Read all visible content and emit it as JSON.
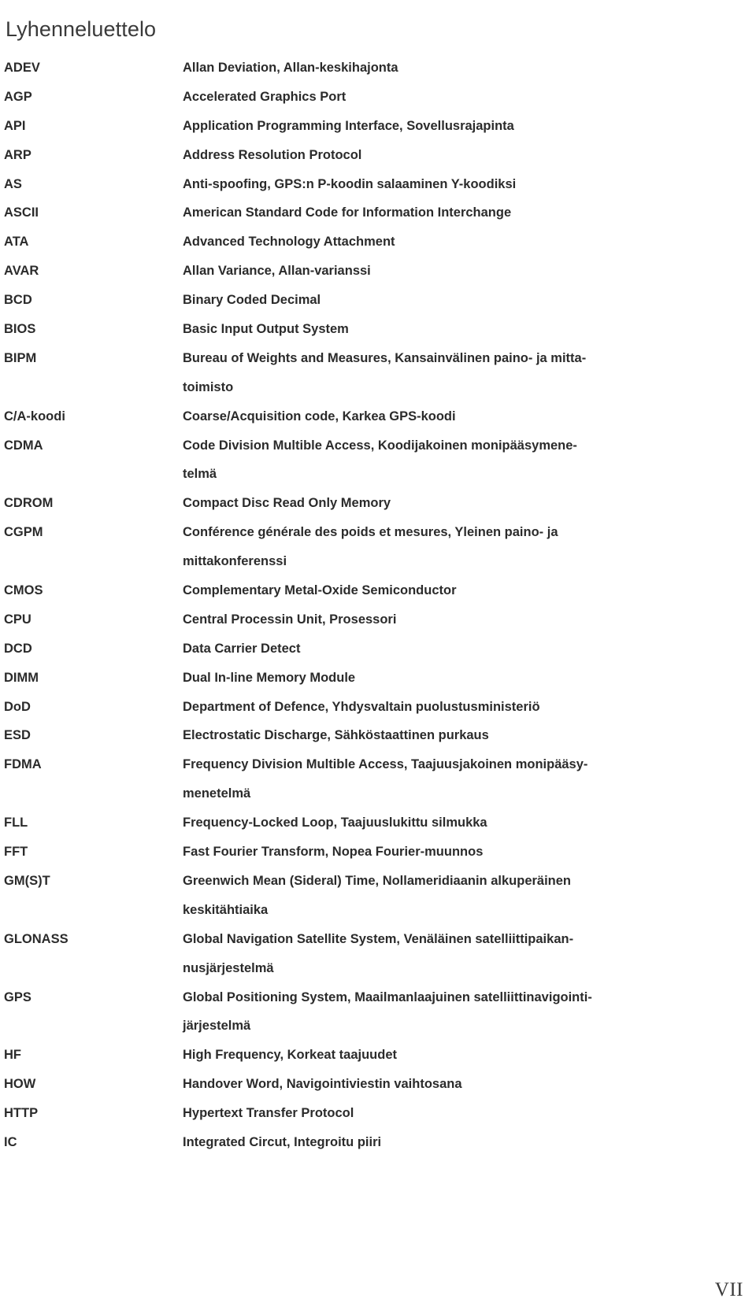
{
  "document": {
    "title": "Lyhenneluettelo",
    "page_number": "VII"
  },
  "entries": [
    {
      "term": "ADEV",
      "lines": [
        "Allan Deviation, Allan-keskihajonta"
      ]
    },
    {
      "term": "AGP",
      "lines": [
        "Accelerated Graphics Port"
      ]
    },
    {
      "term": "API",
      "lines": [
        "Application Programming Interface, Sovellusrajapinta"
      ]
    },
    {
      "term": "ARP",
      "lines": [
        "Address Resolution Protocol"
      ]
    },
    {
      "term": "AS",
      "lines": [
        "Anti-spoofing, GPS:n P-koodin salaaminen Y-koodiksi"
      ]
    },
    {
      "term": "ASCII",
      "lines": [
        "American Standard Code for Information Interchange"
      ]
    },
    {
      "term": "ATA",
      "lines": [
        "Advanced Technology Attachment"
      ]
    },
    {
      "term": "AVAR",
      "lines": [
        "Allan Variance, Allan-varianssi"
      ]
    },
    {
      "term": "BCD",
      "lines": [
        "Binary Coded Decimal"
      ]
    },
    {
      "term": "BIOS",
      "lines": [
        "Basic Input Output System"
      ]
    },
    {
      "term": "BIPM",
      "lines": [
        "Bureau of Weights and Measures, Kansainvälinen paino- ja mitta-",
        "toimisto"
      ]
    },
    {
      "term": "C/A-koodi",
      "lines": [
        "Coarse/Acquisition code, Karkea GPS-koodi"
      ]
    },
    {
      "term": "CDMA",
      "lines": [
        "Code Division Multible Access, Koodijakoinen monipääsymene-",
        "telmä"
      ]
    },
    {
      "term": "CDROM",
      "lines": [
        "Compact Disc Read Only Memory"
      ]
    },
    {
      "term": "CGPM",
      "lines": [
        "Conférence générale des poids et mesures, Yleinen paino- ja",
        "mittakonferenssi"
      ]
    },
    {
      "term": "CMOS",
      "lines": [
        "Complementary Metal-Oxide Semiconductor"
      ]
    },
    {
      "term": "CPU",
      "lines": [
        "Central Processin Unit, Prosessori"
      ]
    },
    {
      "term": "DCD",
      "lines": [
        "Data Carrier Detect"
      ]
    },
    {
      "term": "DIMM",
      "lines": [
        "Dual In-line Memory Module"
      ]
    },
    {
      "term": "DoD",
      "lines": [
        "Department of Defence, Yhdysvaltain puolustusministeriö"
      ]
    },
    {
      "term": "ESD",
      "lines": [
        "Electrostatic Discharge, Sähköstaattinen purkaus"
      ]
    },
    {
      "term": "FDMA",
      "lines": [
        "Frequency Division Multible Access, Taajuusjakoinen monipääsy-",
        "menetelmä"
      ]
    },
    {
      "term": "FLL",
      "lines": [
        "Frequency-Locked Loop, Taajuuslukittu silmukka"
      ]
    },
    {
      "term": "FFT",
      "lines": [
        "Fast Fourier Transform, Nopea Fourier-muunnos"
      ]
    },
    {
      "term": "GM(S)T",
      "lines": [
        "Greenwich Mean (Sideral) Time, Nollameridiaanin alkuperäinen",
        "keskitähtiaika"
      ]
    },
    {
      "term": "GLONASS",
      "lines": [
        "Global Navigation Satellite System, Venäläinen satelliittipaikan-",
        "nusjärjestelmä"
      ]
    },
    {
      "term": "GPS",
      "lines": [
        "Global Positioning System, Maailmanlaajuinen satelliittinavigointi-",
        "järjestelmä"
      ]
    },
    {
      "term": "HF",
      "lines": [
        "High Frequency, Korkeat taajuudet"
      ]
    },
    {
      "term": "HOW",
      "lines": [
        "Handover Word, Navigointiviestin vaihtosana"
      ]
    },
    {
      "term": "HTTP",
      "lines": [
        "Hypertext Transfer Protocol"
      ]
    },
    {
      "term": "IC",
      "lines": [
        "Integrated Circut, Integroitu piiri"
      ]
    }
  ]
}
